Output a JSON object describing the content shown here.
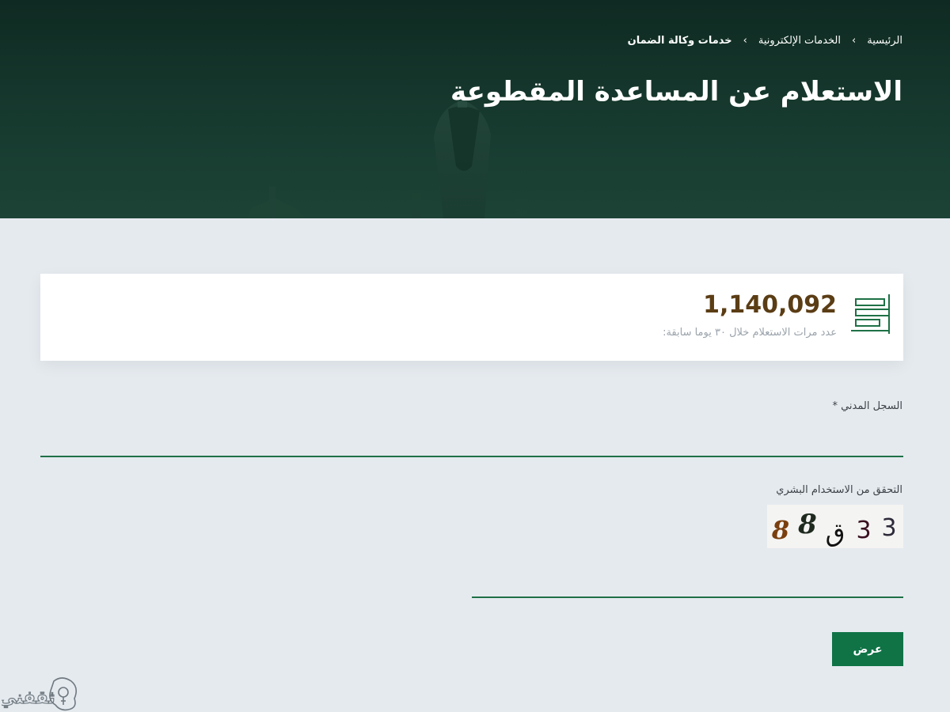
{
  "header": {
    "breadcrumb": [
      "الرئيسية",
      "الخدمات الإلكترونية",
      "خدمات وكالة الضمان"
    ],
    "separator": "›",
    "title": "الاستعلام عن المساعدة المقطوعة"
  },
  "stats": {
    "count": "1,140,092",
    "caption": "عدد مرات الاستعلام خلال ٣٠ يوما سابقة:",
    "icon": "bar-chart-icon"
  },
  "form": {
    "id_label": "السجل المدني *",
    "id_value": "",
    "captcha_label": "التحقق من الاستخدام البشري",
    "captcha_chars": [
      "3",
      "3",
      "ق",
      "8",
      "8"
    ],
    "captcha_value": "",
    "submit_label": "عرض"
  },
  "watermark": {
    "text": "ثقفني",
    "icon": "lightbulb-icon"
  },
  "colors": {
    "hero_dark": "#0f2a22",
    "accent_green": "#0f7346",
    "number_brown": "#5b3d15",
    "page_bg": "#e5eaef"
  }
}
